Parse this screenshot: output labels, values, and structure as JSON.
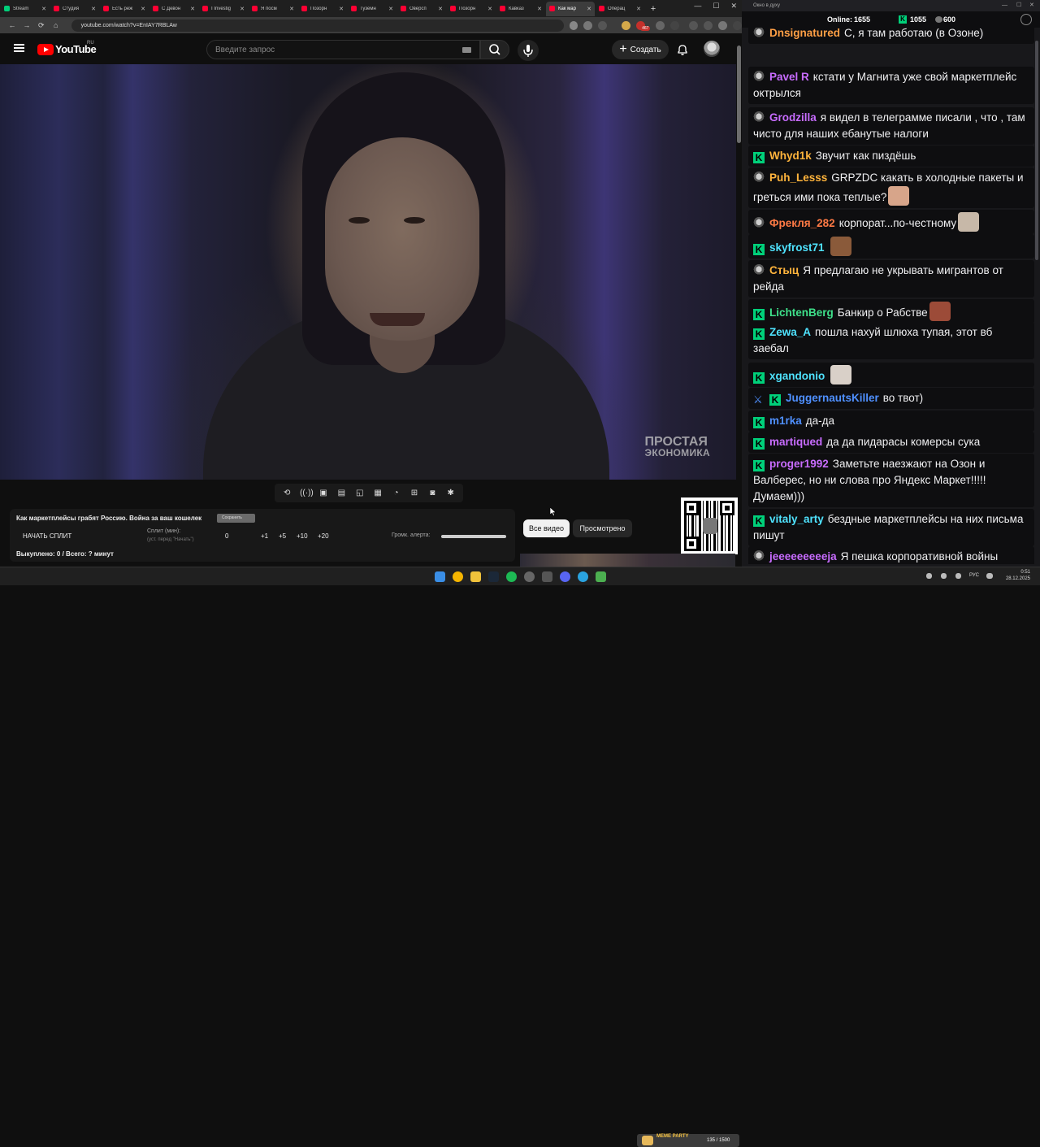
{
  "browser": {
    "tabs": [
      {
        "label": "Stream",
        "color": "#00d07a",
        "active": false
      },
      {
        "label": "Студия",
        "color": "#ff0033",
        "active": false
      },
      {
        "label": "Есть реж",
        "color": "#ff0033",
        "active": false
      },
      {
        "label": "С Девон",
        "color": "#ff0033",
        "active": false
      },
      {
        "label": "I Investig",
        "color": "#ff0033",
        "active": false
      },
      {
        "label": "Я посм",
        "color": "#ff0033",
        "active": false
      },
      {
        "label": "Позорн",
        "color": "#ff0033",
        "active": false
      },
      {
        "label": "Туземн",
        "color": "#ff0033",
        "active": false
      },
      {
        "label": "Оверсп",
        "color": "#ff0033",
        "active": false
      },
      {
        "label": "Позорн",
        "color": "#ff0033",
        "active": false
      },
      {
        "label": "Кавказ",
        "color": "#ff0033",
        "active": false
      },
      {
        "label": "Как мар",
        "color": "#ff0033",
        "active": true
      },
      {
        "label": "Операц",
        "color": "#ff0033",
        "active": false
      }
    ],
    "url": "youtube.com/watch?v=EnIAY7RBLAw",
    "ext_badge": "467"
  },
  "youtube": {
    "logo_text": "YouTube",
    "country": "RU",
    "search_placeholder": "Введите запрос",
    "create_label": "Создать"
  },
  "video": {
    "watermark_line1": "ПРОСТАЯ",
    "watermark_line2": "ЭКОНОМИКА"
  },
  "split_panel": {
    "title": "Как маркетплейсы грабят Россию. Война за ваш кошелек",
    "save_label": "Сохранить",
    "start_label": "НАЧАТЬ СПЛИТ",
    "split_label": "Сплит (мин):",
    "split_hint": "(уст. перед \"Начать\")",
    "split_value": "0",
    "increments": [
      "+1",
      "+5",
      "+10",
      "+20"
    ],
    "volume_label": "Громк. алерта:",
    "volume_level": 1.0,
    "bought": "Выкуплено: 0 / Всего: ? минут"
  },
  "filters": {
    "all_videos": "Все видео",
    "watched": "Просмотрено"
  },
  "chat": {
    "window_title": "Окно в духу",
    "online_label": "Online:",
    "online_count": "1655",
    "stat_k": "1055",
    "stat_coin": "600",
    "messages": [
      {
        "badge": "helm",
        "user": "Dnsignatured",
        "color": "#ff9f45",
        "text": "С, я там работаю (в Озоне)"
      },
      {
        "badge": "helm",
        "user": "Pavel R",
        "color": "#c86cff",
        "text": "кстати у Магнита уже свой маркетплейс октрылся"
      },
      {
        "badge": "helm",
        "user": "Grodzilla",
        "color": "#c86cff",
        "text": "я видел в телеграмме писали , что , там чисто для наших ебанутые налоги"
      },
      {
        "badge": "k",
        "user": "Whyd1k",
        "color": "#ffb43c",
        "text": "Звучит как пиздёшь"
      },
      {
        "badge": "helm",
        "user": "Puh_Lesss",
        "color": "#ffb43c",
        "text": "GRPZDC какать в холодные пакеты и греться ими пока теплые?",
        "mention": "GRPZDC"
      },
      {
        "badge": "helm",
        "user": "Фрекля_282",
        "color": "#ff7a45",
        "text": "корпорат...по-честному"
      },
      {
        "badge": "k",
        "user": "skyfrost71",
        "color": "#4fe3ff",
        "text": ""
      },
      {
        "badge": "helm",
        "user": "Стыц",
        "color": "#ffb43c",
        "text": "Я предлагаю не укрывать мигрантов от рейда"
      },
      {
        "badge": "k",
        "user": "LichtenBerg",
        "color": "#3ee08a",
        "text": "Банкир о Рабстве"
      },
      {
        "badge": "k",
        "user": "Zewa_A",
        "color": "#4fe3ff",
        "text": "пошла нахуй шлюха тупая, этот вб заебал"
      },
      {
        "badge": "k",
        "user": "xgandonio",
        "color": "#4fe3ff",
        "text": ""
      },
      {
        "badge": "k",
        "user": "JuggernautsKiller",
        "color": "#4f90ff",
        "text": "во твот)"
      },
      {
        "badge": "k",
        "user": "m1rka",
        "color": "#4f90ff",
        "text": "да-да"
      },
      {
        "badge": "k",
        "user": "martiqued",
        "color": "#c86cff",
        "text": "да да пидарасы комерсы сука"
      },
      {
        "badge": "k",
        "user": "proger1992",
        "color": "#c86cff",
        "text": "Заметьте наезжают на Озон и Валберес, но ни слова про Яндекс Маркет!!!!! Думаем)))"
      },
      {
        "badge": "k",
        "user": "vitaly_arty",
        "color": "#4fe3ff",
        "text": "бездные маркетплейсы на них письма пишут"
      },
      {
        "badge": "helm",
        "user": "jeeeeeeeeeja",
        "color": "#c86cff",
        "text": "Я пешка корпоративной войны против маркетплейсов"
      }
    ]
  },
  "taskbar": {
    "lang": "РУС",
    "time": "0:51",
    "date": "28.12.2025",
    "meme_party_title": "MEME PARTY",
    "meme_party_count": "135 / 1500"
  }
}
